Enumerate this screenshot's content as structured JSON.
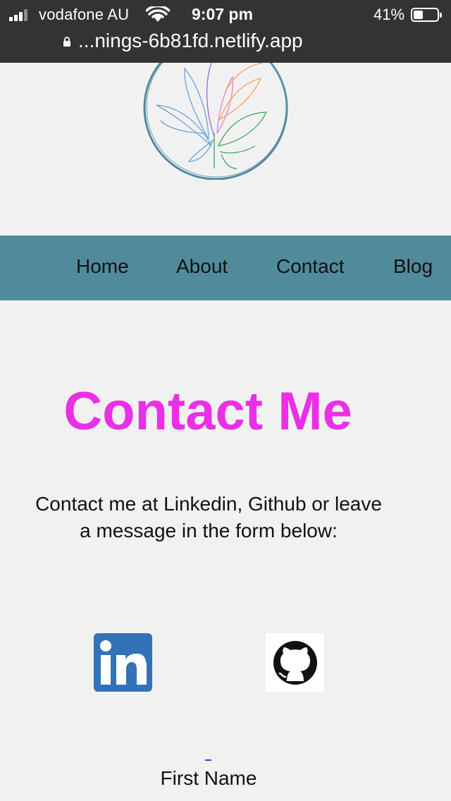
{
  "status_bar": {
    "carrier": "vodafone AU",
    "time": "9:07 pm",
    "battery_percent": "41%",
    "battery_level": 0.41
  },
  "browser": {
    "url": "...nings-6b81fd.netlify.app"
  },
  "nav": {
    "items": [
      {
        "label": "Home"
      },
      {
        "label": "About"
      },
      {
        "label": "Contact"
      },
      {
        "label": "Blog"
      }
    ]
  },
  "main": {
    "title": "Contact Me",
    "intro_line1": "Contact me at Linkedin, Github or leave",
    "intro_line2": "a message in the form below:",
    "social": [
      {
        "icon": "linkedin-icon"
      },
      {
        "icon": "github-icon"
      }
    ],
    "form": {
      "first_name_label": "First Name"
    }
  },
  "colors": {
    "nav_bg": "#518b9b",
    "title": "#e930e6",
    "linkedin": "#3273b7",
    "background": "#f2f1f2"
  }
}
